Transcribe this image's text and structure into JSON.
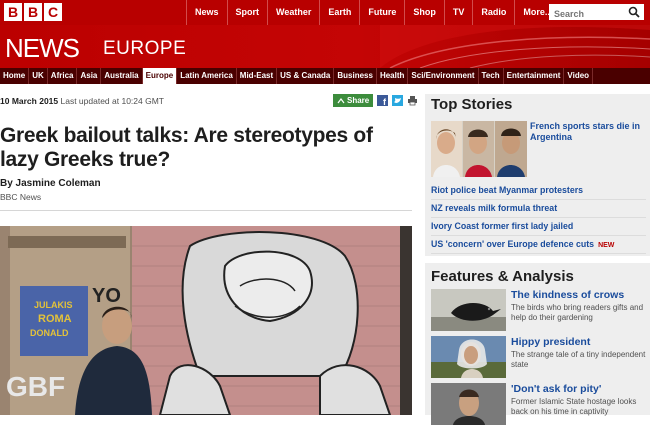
{
  "brand": {
    "logo_letters": [
      "B",
      "B",
      "C"
    ],
    "section_word": "NEWS",
    "region": "EUROPE"
  },
  "topnav": [
    "News",
    "Sport",
    "Weather",
    "Earth",
    "Future",
    "Shop",
    "TV",
    "Radio",
    "More..."
  ],
  "search": {
    "placeholder": "Search"
  },
  "secnav": {
    "items": [
      "Home",
      "UK",
      "Africa",
      "Asia",
      "Australia",
      "Europe",
      "Latin America",
      "Mid-East",
      "US & Canada",
      "Business",
      "Health",
      "Sci/Environment",
      "Tech",
      "Entertainment",
      "Video"
    ],
    "active": "Europe"
  },
  "article": {
    "date": "10 March 2015",
    "updated": "Last updated at 10:24 GMT",
    "share_label": "Share",
    "headline": "Greek bailout talks: Are stereotypes of lazy Greeks true?",
    "byline": "By Jasmine Coleman",
    "byline_role": "BBC News",
    "photo_graffiti": [
      "JULAKIS",
      "ROMA",
      "DONALD",
      "YO",
      "GBF"
    ]
  },
  "top_stories": {
    "heading": "Top Stories",
    "lead": "French sports stars die in Argentina",
    "items": [
      {
        "text": "Riot police beat Myanmar protesters"
      },
      {
        "text": "NZ reveals milk formula threat"
      },
      {
        "text": "Ivory Coast former first lady jailed"
      },
      {
        "text": "US 'concern' over Europe defence cuts",
        "badge": "NEW"
      }
    ]
  },
  "features": {
    "heading": "Features & Analysis",
    "items": [
      {
        "title": "The kindness of crows",
        "summary": "The birds who bring readers gifts and help do their gardening"
      },
      {
        "title": "Hippy president",
        "summary": "The strange tale of a tiny independent state"
      },
      {
        "title": "'Don't ask for pity'",
        "summary": "Former Islamic State hostage looks back on his time in captivity"
      }
    ]
  },
  "colors": {
    "brand_red": "#b80000",
    "link_blue": "#1a4c9c",
    "secnav_bg": "#4a0000"
  }
}
